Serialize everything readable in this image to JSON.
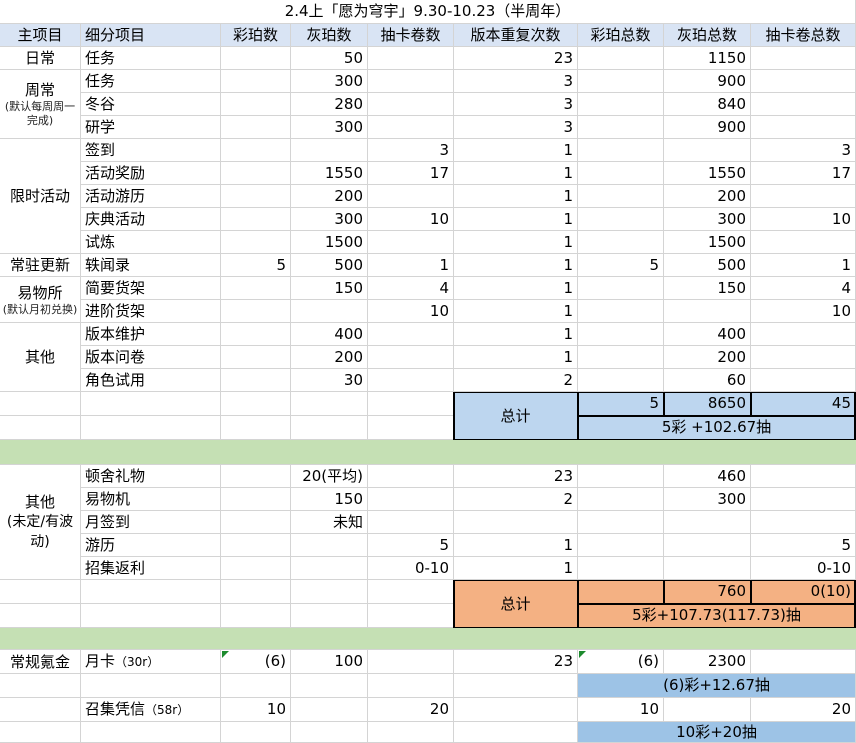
{
  "title": "2.4上「愿为穹宇」9.30-10.23（半周年）",
  "headers": [
    "主项目",
    "细分项目",
    "彩珀数",
    "灰珀数",
    "抽卡卷数",
    "版本重复次数",
    "彩珀总数",
    "灰珀总数",
    "抽卡卷总数"
  ],
  "categories": {
    "daily": "日常",
    "weekly": "周常",
    "weekly_note": "(默认每周周一完成)",
    "limited": "限时活动",
    "resident": "常驻更新",
    "shop": "易物所",
    "shop_note": "(默认月初兑换)",
    "other": "其他",
    "other2": "其他",
    "other2_note": "(未定/有波动)",
    "paid": "常规氪金"
  },
  "rows1": [
    {
      "name": "任务",
      "c": "",
      "h": "50",
      "k": "",
      "rep": "23",
      "tc": "",
      "th": "1150",
      "tk": ""
    },
    {
      "name": "任务",
      "c": "",
      "h": "300",
      "k": "",
      "rep": "3",
      "tc": "",
      "th": "900",
      "tk": ""
    },
    {
      "name": "冬谷",
      "c": "",
      "h": "280",
      "k": "",
      "rep": "3",
      "tc": "",
      "th": "840",
      "tk": ""
    },
    {
      "name": "研学",
      "c": "",
      "h": "300",
      "k": "",
      "rep": "3",
      "tc": "",
      "th": "900",
      "tk": ""
    },
    {
      "name": "签到",
      "c": "",
      "h": "",
      "k": "3",
      "rep": "1",
      "tc": "",
      "th": "",
      "tk": "3"
    },
    {
      "name": "活动奖励",
      "c": "",
      "h": "1550",
      "k": "17",
      "rep": "1",
      "tc": "",
      "th": "1550",
      "tk": "17"
    },
    {
      "name": "活动游历",
      "c": "",
      "h": "200",
      "k": "",
      "rep": "1",
      "tc": "",
      "th": "200",
      "tk": ""
    },
    {
      "name": "庆典活动",
      "c": "",
      "h": "300",
      "k": "10",
      "rep": "1",
      "tc": "",
      "th": "300",
      "tk": "10"
    },
    {
      "name": "试炼",
      "c": "",
      "h": "1500",
      "k": "",
      "rep": "1",
      "tc": "",
      "th": "1500",
      "tk": ""
    },
    {
      "name": "轶闻录",
      "c": "5",
      "h": "500",
      "k": "1",
      "rep": "1",
      "tc": "5",
      "th": "500",
      "tk": "1"
    },
    {
      "name": "简要货架",
      "c": "",
      "h": "150",
      "k": "4",
      "rep": "1",
      "tc": "",
      "th": "150",
      "tk": "4"
    },
    {
      "name": "进阶货架",
      "c": "",
      "h": "",
      "k": "10",
      "rep": "1",
      "tc": "",
      "th": "",
      "tk": "10"
    },
    {
      "name": "版本维护",
      "c": "",
      "h": "400",
      "k": "",
      "rep": "1",
      "tc": "",
      "th": "400",
      "tk": ""
    },
    {
      "name": "版本问卷",
      "c": "",
      "h": "200",
      "k": "",
      "rep": "1",
      "tc": "",
      "th": "200",
      "tk": ""
    },
    {
      "name": "角色试用",
      "c": "",
      "h": "30",
      "k": "",
      "rep": "2",
      "tc": "",
      "th": "60",
      "tk": ""
    }
  ],
  "total1": {
    "label": "总计",
    "c": "5",
    "h": "8650",
    "k": "45",
    "summary": "5彩 +102.67抽"
  },
  "rows2": [
    {
      "name": "顿舍礼物",
      "c": "",
      "h": "20(平均)",
      "k": "",
      "rep": "23",
      "tc": "",
      "th": "460",
      "tk": ""
    },
    {
      "name": "易物机",
      "c": "",
      "h": "150",
      "k": "",
      "rep": "2",
      "tc": "",
      "th": "300",
      "tk": ""
    },
    {
      "name": "月签到",
      "c": "",
      "h": "未知",
      "k": "",
      "rep": "",
      "tc": "",
      "th": "",
      "tk": ""
    },
    {
      "name": "游历",
      "c": "",
      "h": "",
      "k": "5",
      "rep": "1",
      "tc": "",
      "th": "",
      "tk": "5"
    },
    {
      "name": "招集返利",
      "c": "",
      "h": "",
      "k": "0-10",
      "rep": "1",
      "tc": "",
      "th": "",
      "tk": "0-10"
    }
  ],
  "total2": {
    "label": "总计",
    "c": "",
    "h": "760",
    "k": "0(10)",
    "summary": "5彩+107.73(117.73)抽"
  },
  "paid": {
    "monthly": {
      "name": "月卡",
      "price": "（30r）",
      "c": "(6)",
      "h": "100",
      "k": "",
      "rep": "23",
      "tc": "(6)",
      "th": "2300",
      "tk": "",
      "summary": "(6)彩+12.67抽"
    },
    "voucher": {
      "name": "召集凭信",
      "price": "（58r）",
      "c": "10",
      "h": "",
      "k": "20",
      "rep": "",
      "tc": "10",
      "th": "",
      "tk": "20",
      "summary": "10彩+20抽"
    }
  },
  "colors": {
    "header": "#d9e4f4",
    "total_blue": "#bdd6ef",
    "summary_blue": "#9dc3e6",
    "orange": "#f4b183",
    "green": "#c5e0b4",
    "comment_marker": "#1d8b2e"
  }
}
